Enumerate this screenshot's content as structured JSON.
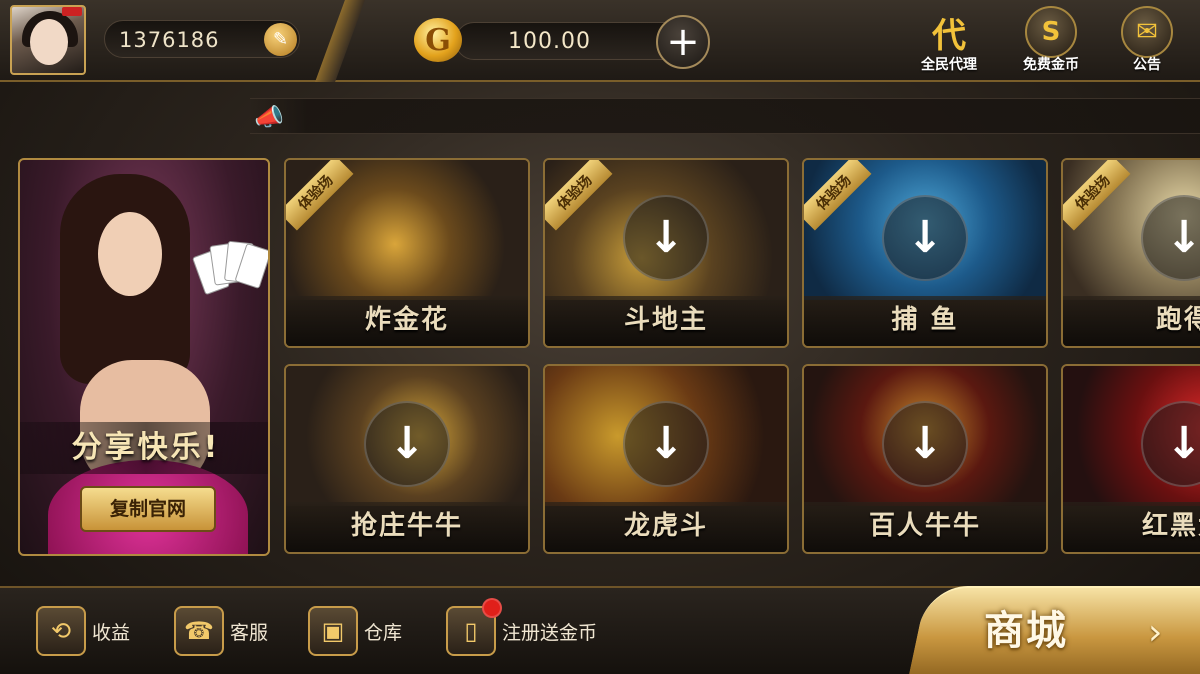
{
  "header": {
    "user_id": "1376186",
    "coin_balance": "100.00",
    "right_icons": [
      {
        "label": "全民代理",
        "glyph": "代",
        "icon": "agent-icon"
      },
      {
        "label": "免费金币",
        "glyph": "S",
        "icon": "coin-dollar-icon"
      },
      {
        "label": "公告",
        "glyph": "✉",
        "icon": "mail-icon"
      }
    ]
  },
  "promo": {
    "title": "分享快乐!",
    "button": "复制官网"
  },
  "games": [
    {
      "name": "炸金花",
      "ribbon": "体验场",
      "download": false
    },
    {
      "name": "斗地主",
      "ribbon": "体验场",
      "download": true
    },
    {
      "name": "捕 鱼",
      "ribbon": "体验场",
      "download": true
    },
    {
      "name": "跑得",
      "ribbon": "体验场",
      "download": true
    },
    {
      "name": "抢庄牛牛",
      "ribbon": "",
      "download": true
    },
    {
      "name": "龙虎斗",
      "ribbon": "",
      "download": true
    },
    {
      "name": "百人牛牛",
      "ribbon": "",
      "download": true
    },
    {
      "name": "红黑大",
      "ribbon": "",
      "download": true
    }
  ],
  "bottom": {
    "items": [
      {
        "label": "收益",
        "glyph": "⟲",
        "icon": "refresh-icon"
      },
      {
        "label": "客服",
        "glyph": "☎",
        "icon": "headset-icon"
      },
      {
        "label": "仓库",
        "glyph": "▣",
        "icon": "safe-icon"
      },
      {
        "label": "注册送金币",
        "glyph": "▯",
        "icon": "phone-icon",
        "badge": true
      }
    ],
    "shop_label": "商城",
    "shop_arrow": "›"
  },
  "icons": {
    "edit": "✎",
    "coin": "G",
    "plus": "+",
    "horn": "📣",
    "download": "↓"
  }
}
